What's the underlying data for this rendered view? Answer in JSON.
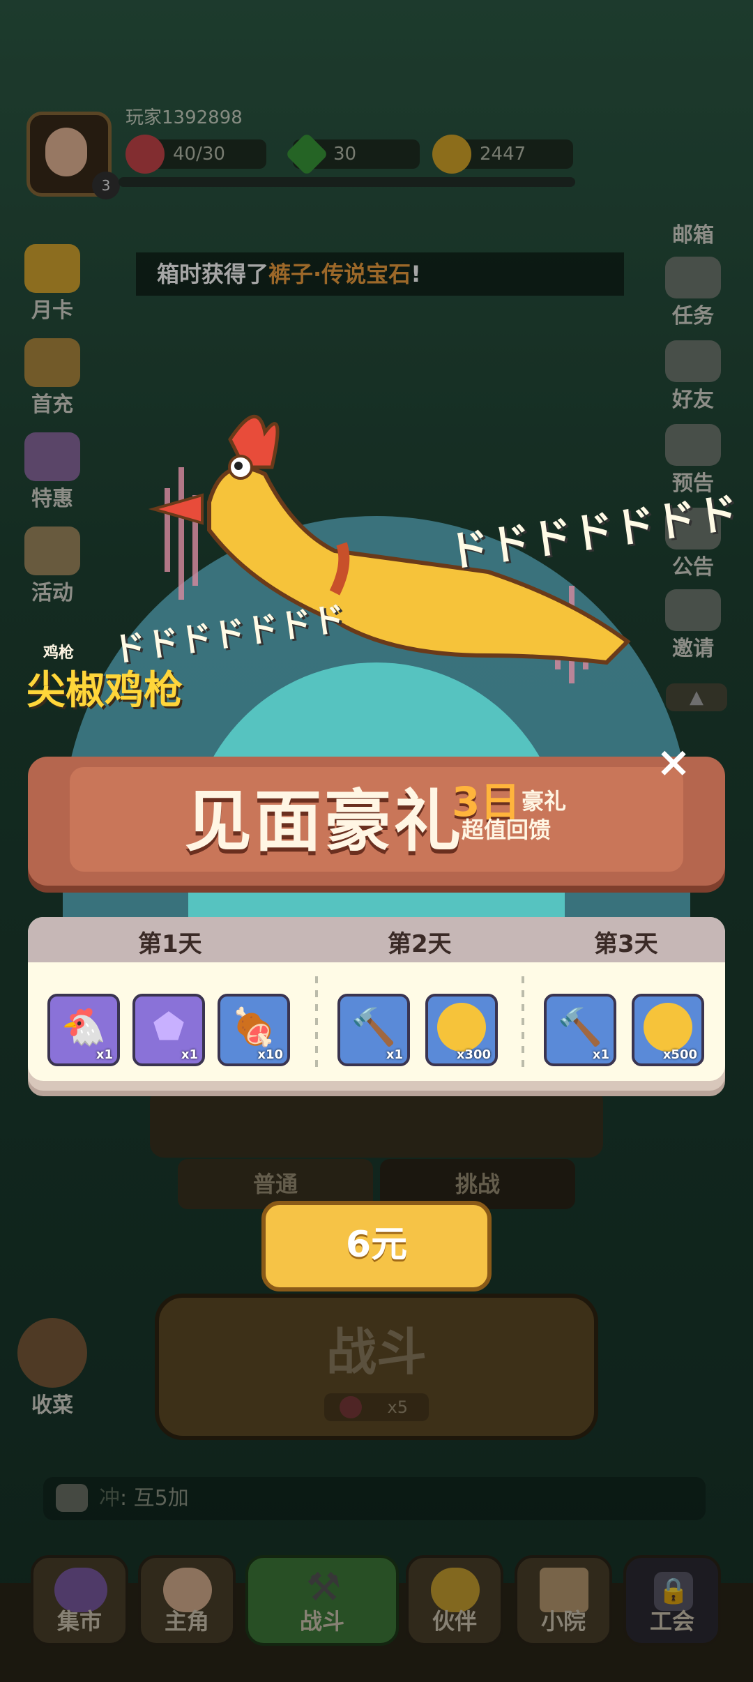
{
  "player": {
    "name": "玩家1392898",
    "level": "3"
  },
  "resources": [
    {
      "icon": "meat-icon",
      "value": "40/30"
    },
    {
      "icon": "gem-icon",
      "value": "30"
    },
    {
      "icon": "coin-icon",
      "value": "2447"
    }
  ],
  "left_menu": [
    {
      "label": "月卡",
      "icon": "month-card-icon"
    },
    {
      "label": "首充",
      "icon": "first-recharge-icon"
    },
    {
      "label": "特惠",
      "icon": "special-offer-icon"
    },
    {
      "label": "活动",
      "icon": "event-icon"
    }
  ],
  "right_menu": [
    {
      "label": "邮箱",
      "icon": "mail-icon"
    },
    {
      "label": "任务",
      "icon": "task-icon"
    },
    {
      "label": "好友",
      "icon": "friend-icon"
    },
    {
      "label": "预告",
      "icon": "preview-icon"
    },
    {
      "label": "公告",
      "icon": "announcement-icon"
    },
    {
      "label": "邀请",
      "icon": "invite-icon"
    }
  ],
  "ticker": {
    "prefix": "箱时获得了",
    "highlight": "裤子·传说宝石",
    "suffix": "!"
  },
  "hero": {
    "small_label": "鸡枪",
    "name": "尖椒鸡枪",
    "sfx": "ドドドドドドド"
  },
  "modal": {
    "title": "见面豪礼",
    "badge_big": "3日",
    "badge_small": "豪礼",
    "subtitle": "超值回馈",
    "close": "×",
    "days": [
      {
        "label": "第1天",
        "items": [
          {
            "icon": "chicken-gun-icon",
            "qty": "x1",
            "color": "purple"
          },
          {
            "icon": "purple-gem-icon",
            "qty": "x1",
            "color": "purple"
          },
          {
            "icon": "meat-icon",
            "qty": "x10",
            "color": "blue"
          }
        ]
      },
      {
        "label": "第2天",
        "items": [
          {
            "icon": "hammer-icon",
            "qty": "x1",
            "color": "blue"
          },
          {
            "icon": "coin-icon",
            "qty": "x300",
            "color": "blue"
          }
        ]
      },
      {
        "label": "第3天",
        "items": [
          {
            "icon": "hammer-icon",
            "qty": "x1",
            "color": "blue"
          },
          {
            "icon": "coin-icon",
            "qty": "x500",
            "color": "blue"
          }
        ]
      }
    ],
    "price": "6元"
  },
  "modes": {
    "normal": "普通",
    "challenge": "挑战"
  },
  "fight": {
    "label": "战斗",
    "cost": "x5"
  },
  "harvest": "收菜",
  "chat": {
    "prefix": "冲",
    "text": ": 互5加"
  },
  "bottom_nav": [
    "集市",
    "主角",
    "战斗",
    "伙伴",
    "小院",
    "工会"
  ],
  "colors": {
    "accent": "#f6c346",
    "banner": "#b5664e",
    "highlight": "#f0a040"
  }
}
